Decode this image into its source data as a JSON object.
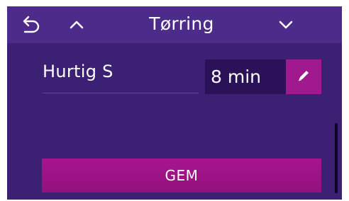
{
  "header": {
    "title": "Tørring",
    "back_icon": "back-arrow-icon",
    "up_icon": "chevron-up-icon",
    "down_icon": "chevron-down-icon"
  },
  "setting": {
    "program_name": "Hurtig S",
    "time_value": "8 min",
    "edit_icon": "pencil-icon"
  },
  "actions": {
    "save_label": "GEM"
  },
  "colors": {
    "background": "#3c2074",
    "header": "#4c2b8a",
    "accent": "#a0198f",
    "value_box": "#2a1158"
  }
}
